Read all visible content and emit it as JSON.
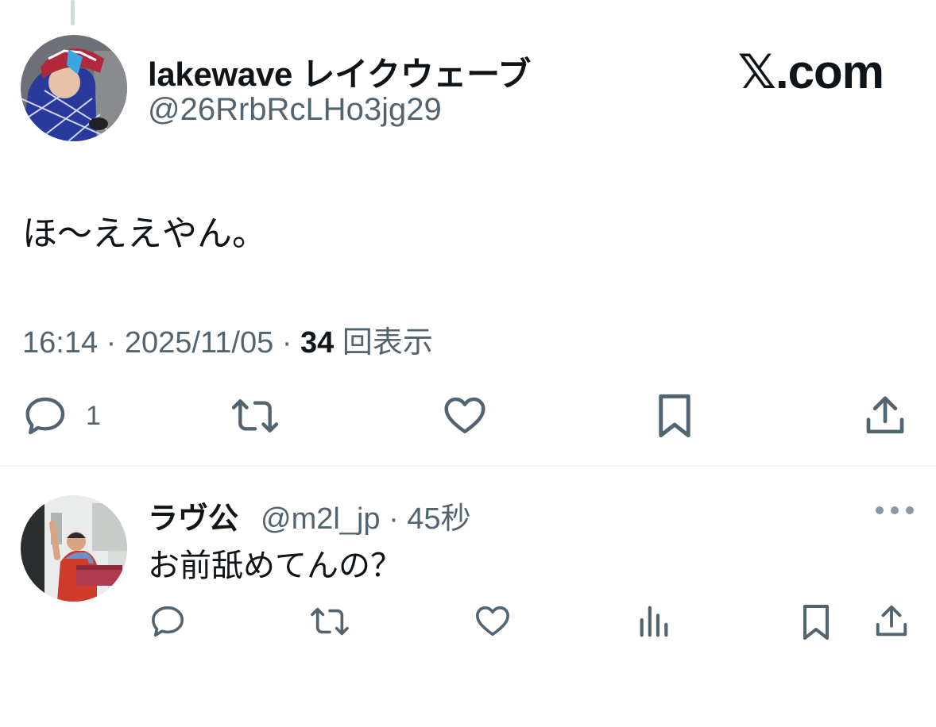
{
  "main_tweet": {
    "display_name": "lakewave レイクウェーブ",
    "handle": "@26RrbRcLHo3jg29",
    "text": "ほ〜ええやん。",
    "time": "16:14",
    "date": "2025/11/05",
    "views_count": "34",
    "views_label": "回表示",
    "reply_count": "1"
  },
  "brand": "𝕏.com",
  "reply": {
    "display_name": "ラヴ公",
    "handle": "@m2l_jp",
    "age": "45秒",
    "text": "お前舐めてんの？"
  },
  "icons": {
    "reply": "reply-icon",
    "repost": "repost-icon",
    "like": "heart-icon",
    "bookmark": "bookmark-icon",
    "share": "share-icon",
    "views": "analytics-icon",
    "more": "more-icon"
  },
  "colors": {
    "text": "#0f1419",
    "muted": "#536471",
    "divider": "#eff3f4"
  }
}
